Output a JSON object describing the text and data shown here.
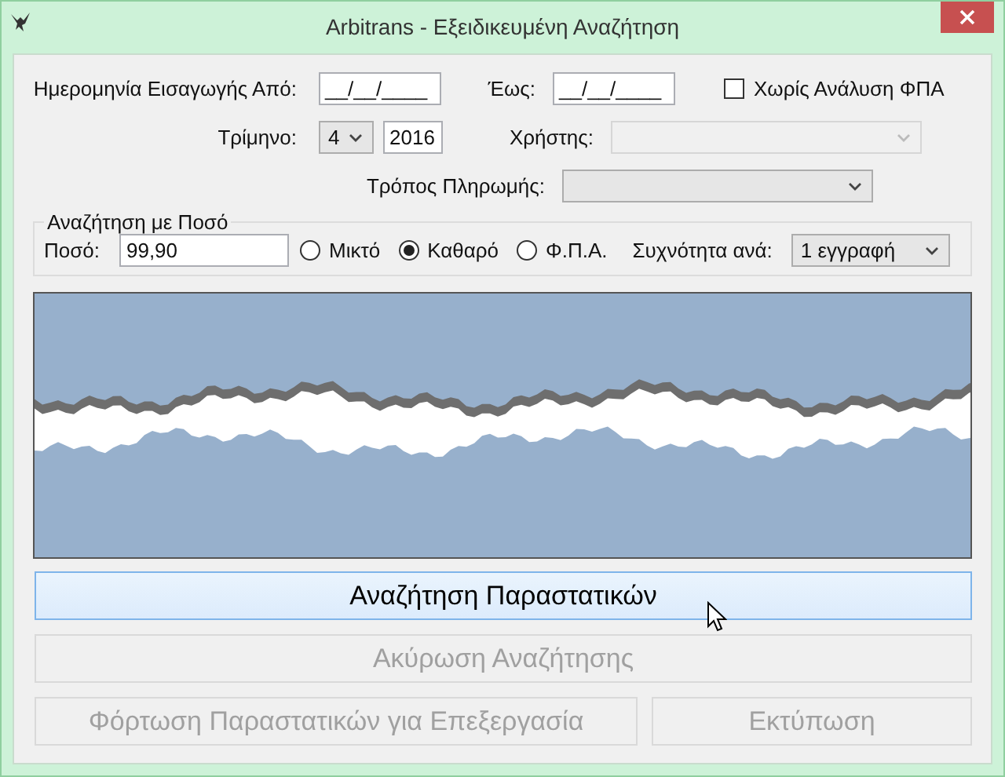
{
  "window": {
    "title": "Arbitrans - Εξειδικευμένη Αναζήτηση"
  },
  "date_from": {
    "label": "Ημερομηνία Εισαγωγής Από:",
    "value": "__/__/____"
  },
  "date_to": {
    "label": "Έως:",
    "value": "__/__/____"
  },
  "no_vat_breakdown": {
    "label": "Χωρίς Ανάλυση ΦΠΑ",
    "checked": false
  },
  "quarter": {
    "label": "Τρίμηνο:",
    "value": "4"
  },
  "year": {
    "value": "2016"
  },
  "user": {
    "label": "Χρήστης:",
    "disabled": true
  },
  "payment_method": {
    "label": "Τρόπος Πληρωμής:",
    "disabled": false
  },
  "amount_search": {
    "title": "Αναζήτηση με Ποσό",
    "amount": {
      "label": "Ποσό:",
      "value": "99,90"
    },
    "options": [
      {
        "label": "Μικτό",
        "selected": false
      },
      {
        "label": "Καθαρό",
        "selected": true
      },
      {
        "label": "Φ.Π.Α.",
        "selected": false
      }
    ],
    "frequency": {
      "label": "Συχνότητα ανά:",
      "value": "1 εγγραφή"
    }
  },
  "buttons": [
    {
      "label": "Αναζήτηση Παραστατικών",
      "kind": "wide",
      "disabled": false,
      "hovered": true
    },
    {
      "label": "Ακύρωση Αναζήτησης",
      "kind": "wide",
      "disabled": true,
      "hovered": false
    },
    {
      "label": "Φόρτωση Παραστατικών για Επεξεργασία",
      "kind": "half",
      "disabled": true,
      "hovered": false
    },
    {
      "label": "Εκτύπωση",
      "kind": "small",
      "disabled": true,
      "hovered": false
    }
  ]
}
